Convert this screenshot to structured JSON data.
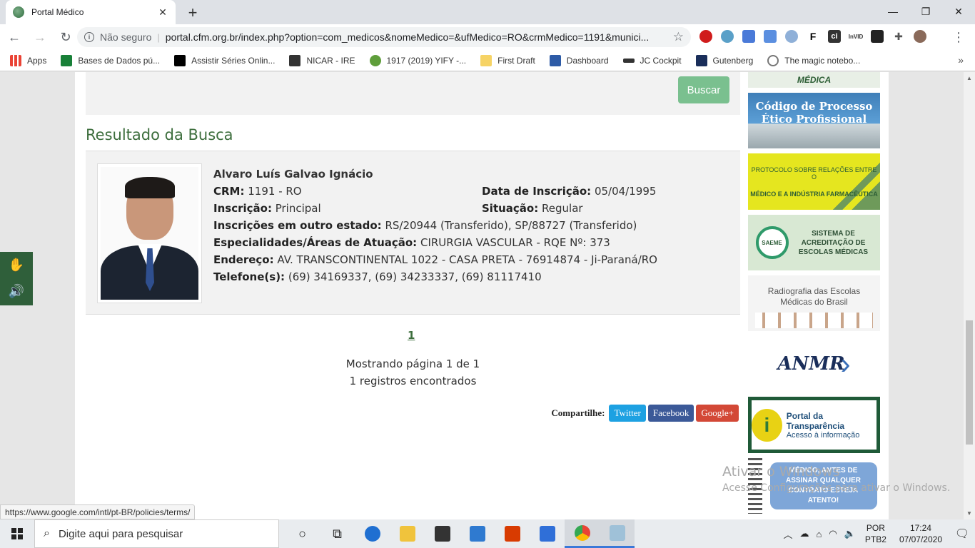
{
  "browser": {
    "tab_title": "Portal Médico",
    "security_label": "Não seguro",
    "url": "portal.cfm.org.br/index.php?option=com_medicos&nomeMedico=&ufMedico=RO&crmMedico=1191&munici...",
    "bookmarks": [
      {
        "label": "Apps",
        "color": "#ea4335"
      },
      {
        "label": "Bases de Dados pú...",
        "color": "#188038"
      },
      {
        "label": "Assistir Séries Onlin...",
        "color": "#000000"
      },
      {
        "label": "NICAR - IRE",
        "color": "#333333"
      },
      {
        "label": "1917 (2019) YIFY -...",
        "color": "#5f9e3b"
      },
      {
        "label": "First Draft",
        "color": "#f6d365"
      },
      {
        "label": "Dashboard",
        "color": "#2d5ba6"
      },
      {
        "label": "JC Cockpit",
        "color": "#333333"
      },
      {
        "label": "Gutenberg",
        "color": "#1a2e5a"
      },
      {
        "label": "The magic notebo...",
        "color": "#777777"
      }
    ]
  },
  "search": {
    "button_label": "Buscar"
  },
  "result": {
    "section_title": "Resultado da Busca",
    "name": "Alvaro Luís Galvao Ignácio",
    "crm_label": "CRM:",
    "crm_value": "1191 - RO",
    "data_inscricao_label": "Data de Inscrição:",
    "data_inscricao_value": "05/04/1995",
    "inscricao_label": "Inscrição:",
    "inscricao_value": "Principal",
    "situacao_label": "Situação:",
    "situacao_value": "Regular",
    "outros_label": "Inscrições em outro estado:",
    "outros_value": "RS/20944 (Transferido), SP/88727 (Transferido)",
    "especialidades_label": "Especialidades/Áreas de Atuação:",
    "especialidades_value": "CIRURGIA VASCULAR - RQE Nº: 373",
    "endereco_label": "Endereço:",
    "endereco_value": "AV. TRANSCONTINENTAL 1022 - CASA PRETA - 76914874 - Ji-Paraná/RO",
    "telefone_label": "Telefone(s):",
    "telefone_value": "(69) 34169337, (69) 34233337, (69) 81117410"
  },
  "pagination": {
    "page_link": "1",
    "showing": "Mostrando página 1 de 1",
    "records": "1 registros encontrados"
  },
  "share": {
    "label": "Compartilhe:",
    "twitter": "Twitter",
    "facebook": "Facebook",
    "google": "Google+"
  },
  "banners": {
    "top_partial": "MÉDICA",
    "codigo": "Código de Processo Ético Profissional",
    "protocolo_1": "PROTOCOLO SOBRE RELAÇÕES ENTRE O",
    "protocolo_2": "MÉDICO E A INDÚSTRIA FARMACÊUTICA",
    "saeme_logo": "SAEME",
    "saeme": "SISTEMA DE ACREDITAÇÃO DE ESCOLAS MÉDICAS",
    "radiografia": "Radiografia das Escolas Médicas do Brasil",
    "anmr": "ANMR",
    "transparencia_1": "Portal da Transparência",
    "transparencia_2": "Acesso à informação",
    "contrato": "MÉDICO, ANTES DE ASSINAR QUALQUER CONTRATO ESTEJA ATENTO!"
  },
  "watermark": {
    "line1": "Ativar o Windows",
    "line2": "Acesse Configurações para ativar o Windows."
  },
  "status_bar_url": "https://www.google.com/intl/pt-BR/policies/terms/",
  "taskbar": {
    "search_placeholder": "Digite aqui para pesquisar",
    "lang1": "POR",
    "lang2": "PTB2",
    "time": "17:24",
    "date": "07/07/2020"
  }
}
